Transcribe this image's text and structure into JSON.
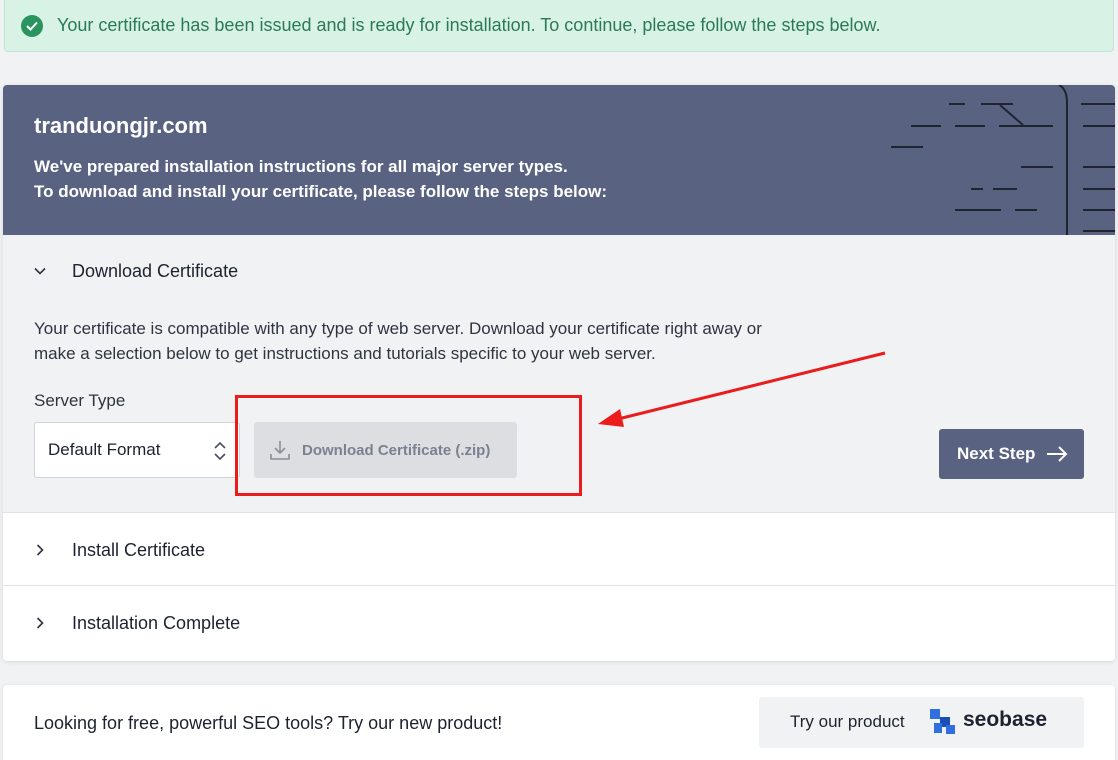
{
  "alert": {
    "message": "Your certificate has been issued and is ready for installation. To continue, please follow the steps below."
  },
  "hero": {
    "domain": "tranduongjr.com",
    "line1": "We've prepared installation instructions for all major server types.",
    "line2": "To download and install your certificate, please follow the steps below:"
  },
  "steps": [
    {
      "label": "Download Certificate",
      "expanded": true
    },
    {
      "label": "Install Certificate",
      "expanded": false
    },
    {
      "label": "Installation Complete",
      "expanded": false
    }
  ],
  "download": {
    "description": "Your certificate is compatible with any type of web server. Download your certificate right away or make a selection below to get instructions and tutorials specific to your web server.",
    "server_type_label": "Server Type",
    "server_type_value": "Default Format",
    "download_button": "Download Certificate (.zip)",
    "next_button": "Next Step"
  },
  "promo": {
    "text": "Looking for free, powerful SEO tools? Try our new product!",
    "try_label": "Try our product",
    "brand": "seobase"
  },
  "colors": {
    "hero_bg": "#596381",
    "success_bg": "#d9f2e6",
    "success_text": "#2a7a55",
    "annotation_red": "#ea1c1c",
    "brand_blue": "#2f6fe0"
  },
  "icons": [
    "check-circle-icon",
    "chevron-down-icon",
    "chevron-right-icon",
    "updown-icon",
    "download-icon",
    "arrow-right-icon",
    "seobase-logo-icon"
  ]
}
